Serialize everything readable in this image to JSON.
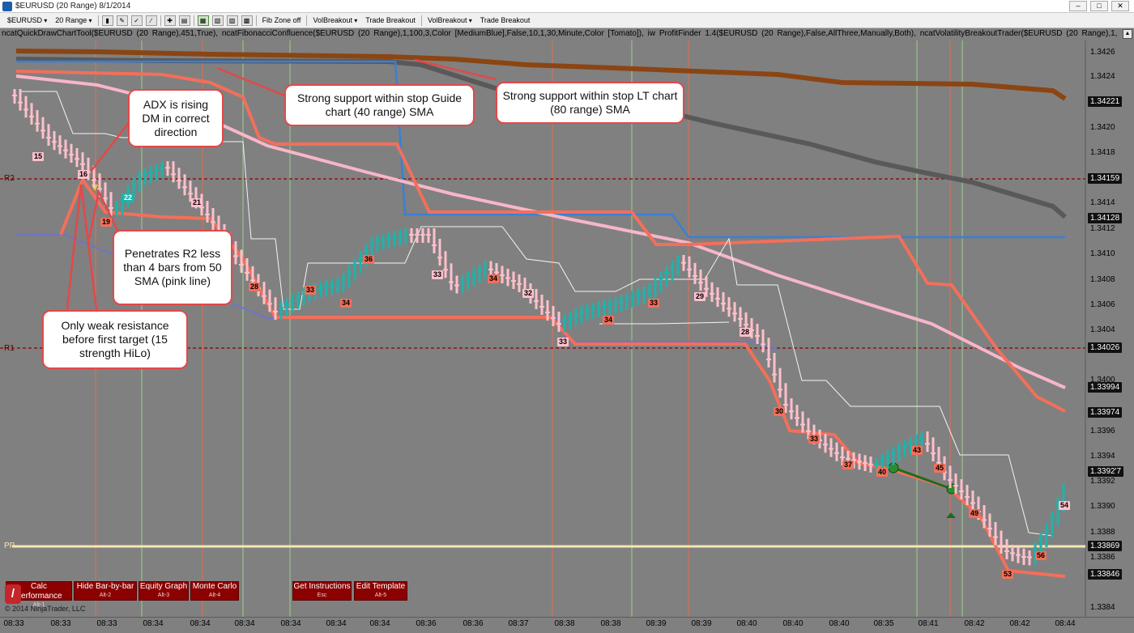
{
  "window": {
    "title": "$EURUSD (20 Range)  8/1/2014",
    "controls": [
      "–",
      "□",
      "✕"
    ]
  },
  "toolbar": {
    "instrument": "$EURUSD",
    "period": "20 Range",
    "fib_zone": "Fib Zone off",
    "vol_breakout_1": "VolBreakout",
    "trade_breakout_1": "Trade Breakout",
    "vol_breakout_2": "VolBreakout",
    "trade_breakout_2": "Trade Breakout"
  },
  "indicator_line": "ncatQuickDrawChartTool($EURUSD (20 Range),451,True), ncatFibonacciConfluence($EURUSD (20 Range),1,100,3,Color [MediumBlue],False,10,1,30,Minute,Color [Tomato]), iw ProfitFinder 1.4($EURUSD (20 Range),False,AllThree,Manually,Both), ncatVolatilityBreakoutTrader($EURUSD (20 Range),1,",
  "price_axis": {
    "labels": [
      "1.3426",
      "1.3424",
      "1.3420",
      "1.3418",
      "1.3414",
      "1.3412",
      "1.3410",
      "1.3408",
      "1.3406",
      "1.3404",
      "1.3400",
      "1.3396",
      "1.3394",
      "1.3392",
      "1.3390",
      "1.3388",
      "1.3386",
      "1.3384"
    ],
    "tags": [
      "1.34221",
      "1.34159",
      "1.34128",
      "1.34026",
      "1.33994",
      "1.33974",
      "1.3392'7",
      "1.33869",
      "1.33846"
    ]
  },
  "levels": {
    "r2": "R2",
    "r1": "R1",
    "pp": "PP"
  },
  "time_axis": [
    "08:33",
    "08:33",
    "08:33",
    "08:34",
    "08:34",
    "08:34",
    "08:34",
    "08:34",
    "08:34",
    "08:35",
    "08:36",
    "08:36",
    "08:37",
    "08:38",
    "08:38",
    "08:39",
    "08:39",
    "08:40",
    "08:40",
    "08:40",
    "08:41",
    "08:42",
    "08:42",
    "08:44"
  ],
  "bar_numbers": [
    "15",
    "16",
    "22",
    "19",
    "21",
    "28",
    "33",
    "34",
    "36",
    "33",
    "34",
    "32",
    "33",
    "34",
    "33",
    "29",
    "28",
    "30",
    "33",
    "37",
    "40",
    "43",
    "45",
    "49",
    "53",
    "56",
    "54"
  ],
  "annotations": {
    "adx": "ADX is rising DM in correct direction",
    "support_guide": "Strong support within stop Guide chart (40 range) SMA",
    "support_lt": "Strong support within stop LT chart (80 range) SMA",
    "penetrates": "Penetrates R2 less than 4 bars from 50 SMA (pink line)",
    "weak_resistance": "Only weak resistance before first target (15 strength HiLo)"
  },
  "performance_buttons": [
    {
      "label": "Calc Performance",
      "key": "Alt-1"
    },
    {
      "label": "Hide Bar-by-bar",
      "key": "Alt-2"
    },
    {
      "label": "Equity Graph",
      "key": "Alt-3"
    },
    {
      "label": "Monte Carlo",
      "key": "Alt-4"
    },
    {
      "label": "Get Instructions",
      "key": "Esc"
    },
    {
      "label": "Edit Template",
      "key": "Alt-5"
    }
  ],
  "copyright": "© 2014 NinjaTrader, LLC",
  "colors": {
    "background": "#808080",
    "up_bar": "#20b2aa",
    "down_bar": "#ffc0cb",
    "sma_pink": "#f7b6c8",
    "stop_salmon": "#f36f5a",
    "lt_sma": "#8b4513",
    "dark_sma": "#555555",
    "blue_line": "#3a7fd6",
    "pivot_line": "#8b0000",
    "pp_line": "#f5e7b0"
  }
}
